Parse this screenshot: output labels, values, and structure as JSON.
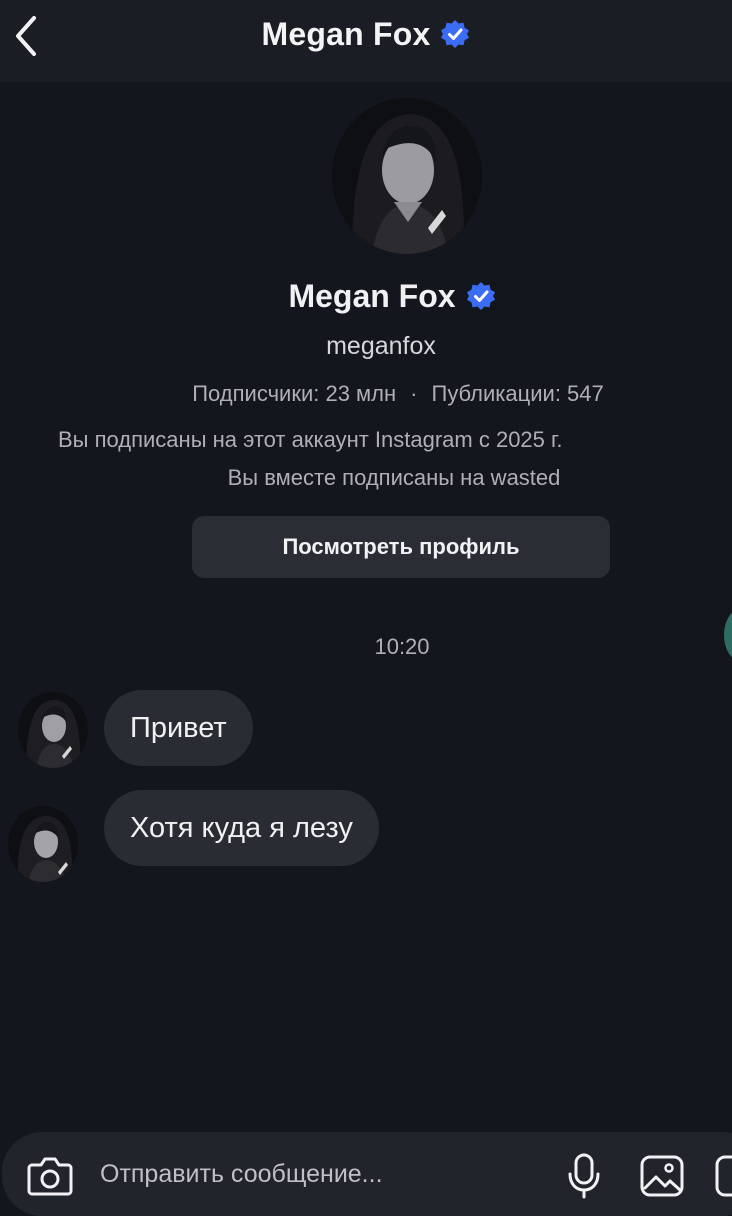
{
  "header": {
    "title": "Megan Fox"
  },
  "profile": {
    "name": "Megan Fox",
    "username": "meganfox",
    "followers": "Подписчики: 23 млн",
    "separator": "·",
    "posts": "Публикации: 547",
    "follow_since": "Вы подписаны на этот аккаунт Instagram с 2025 г.",
    "mutual": "Вы вместе подписаны на wasted",
    "view_profile_label": "Посмотреть профиль"
  },
  "chat": {
    "timestamp": "10:20",
    "messages": [
      {
        "text": "Привет"
      },
      {
        "text": "Хотя куда я лезу"
      }
    ]
  },
  "composer": {
    "placeholder": "Отправить сообщение..."
  },
  "colors": {
    "background": "#14161d",
    "header": "#1b1d24",
    "bubble": "#2a2c33",
    "button": "#2b2d35",
    "verified": "#3b6cf6"
  },
  "icons": [
    "chevron-left-icon",
    "verified-badge-icon",
    "camera-icon",
    "microphone-icon",
    "gallery-icon",
    "sticker-icon"
  ]
}
